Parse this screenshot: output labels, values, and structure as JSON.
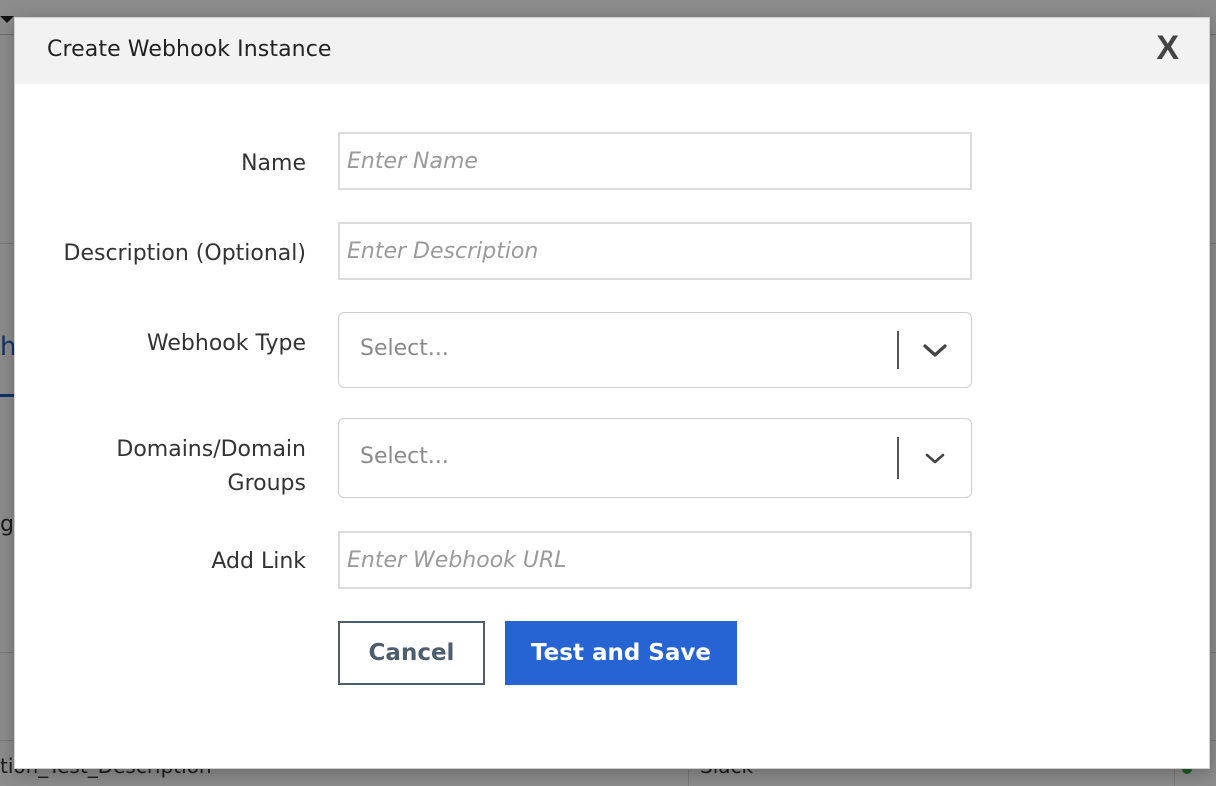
{
  "background": {
    "tab_fragment": "h",
    "row_fragment": "g",
    "table_cell_left": "tion_Test_Description",
    "table_cell_right": "Slack"
  },
  "modal": {
    "title": "Create Webhook Instance",
    "close_label": "X"
  },
  "form": {
    "name": {
      "label": "Name",
      "value": "",
      "placeholder": "Enter Name"
    },
    "description": {
      "label": "Description (Optional)",
      "value": "",
      "placeholder": "Enter Description"
    },
    "webhook_type": {
      "label": "Webhook Type",
      "value": "Select..."
    },
    "domains": {
      "label_line1": "Domains/Domain",
      "label_line2": "Groups",
      "value": "Select..."
    },
    "link": {
      "label": "Add Link",
      "value": "",
      "placeholder": "Enter Webhook URL"
    }
  },
  "buttons": {
    "cancel": "Cancel",
    "save": "Test and Save"
  },
  "colors": {
    "primary": "#2764d3",
    "cancel_border": "#4c5e6e",
    "header_bg": "#f2f2f2"
  }
}
